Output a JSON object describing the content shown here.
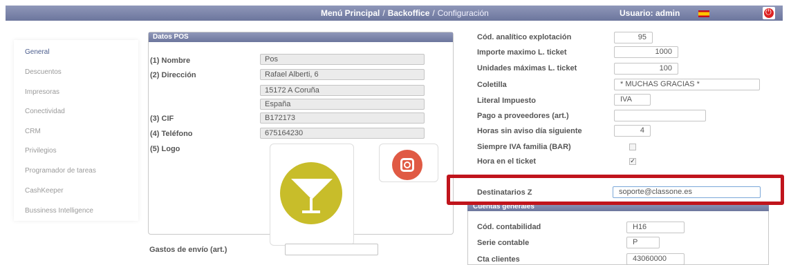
{
  "header": {
    "breadcrumb": [
      "Menú Principal",
      "Backoffice",
      "Configuración"
    ],
    "user_label": "Usuario: admin",
    "flag_icon": "spain-flag-icon",
    "logout_icon": "power-icon"
  },
  "sidebar": {
    "items": [
      {
        "label": "General",
        "active": true
      },
      {
        "label": "Descuentos"
      },
      {
        "label": "Impresoras"
      },
      {
        "label": "Conectividad"
      },
      {
        "label": "CRM"
      },
      {
        "label": "Privilegios"
      },
      {
        "label": "Programador de tareas"
      },
      {
        "label": "CashKeeper"
      },
      {
        "label": "Bussiness Intelligence"
      }
    ]
  },
  "datos_pos": {
    "title": "Datos POS",
    "nombre_label": "(1) Nombre",
    "nombre": "Pos",
    "direccion_label": "(2) Dirección",
    "direccion": [
      "Rafael Alberti, 6",
      "15172 A Coruña",
      "España"
    ],
    "cif_label": "(3) CIF",
    "cif": "B172173",
    "telefono_label": "(4) Teléfono",
    "telefono": "675164230",
    "logo_label": "(5) Logo"
  },
  "gastos_envio": {
    "label": "Gastos de envío (art.)",
    "value": ""
  },
  "config": {
    "cod_analitico": {
      "label": "Cód. analítico explotación",
      "value": "95"
    },
    "importe_max": {
      "label": "Importe maximo L. ticket",
      "value": "1000"
    },
    "unidades_max": {
      "label": "Unidades máximas L. ticket",
      "value": "100"
    },
    "coletilla": {
      "label": "Coletilla",
      "value": "* MUCHAS GRACIAS *"
    },
    "literal_impuesto": {
      "label": "Literal Impuesto",
      "value": "IVA"
    },
    "pago_proveedores": {
      "label": "Pago a proveedores (art.)",
      "value": ""
    },
    "horas_sin_aviso": {
      "label": "Horas sin aviso día siguiente",
      "value": "4"
    },
    "siempre_iva": {
      "label": "Siempre IVA familia (BAR)",
      "checked": false
    },
    "hora_ticket": {
      "label": "Hora en el ticket",
      "checked": true
    },
    "destinatarios_z": {
      "label": "Destinatarios Z",
      "value": "soporte@classone.es"
    }
  },
  "cuentas": {
    "title": "Cuentas generales",
    "cod_contabilidad": {
      "label": "Cód. contabilidad",
      "value": "H16"
    },
    "serie_contable": {
      "label": "Serie contable",
      "value": "P"
    },
    "cta_clientes": {
      "label": "Cta clientes",
      "value": "43060000"
    }
  },
  "colors": {
    "header": "#7a83a8",
    "highlight": "#c0141c",
    "active_nav": "#4a5c8c"
  }
}
